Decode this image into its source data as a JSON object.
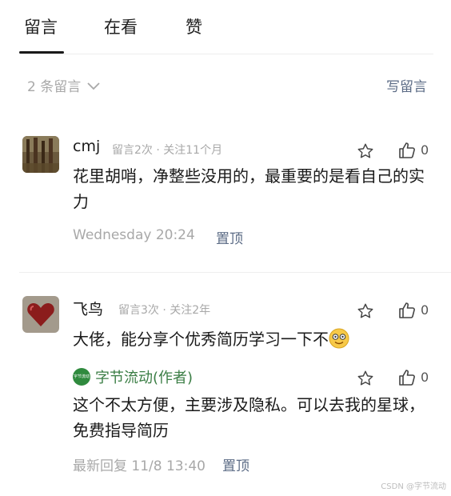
{
  "tabs": [
    {
      "label": "留言",
      "active": true
    },
    {
      "label": "在看"
    },
    {
      "label": "赞"
    }
  ],
  "sort": {
    "count_label": "2 条留言",
    "write_label": "写留言"
  },
  "comments": [
    {
      "name": "cmj",
      "meta": "留言2次 · 关注11个月",
      "likes": "0",
      "text": "花里胡哨，净整些没用的，最重要的是看自己的实力",
      "time": "Wednesday  20:24",
      "pin_label": "置顶"
    },
    {
      "name": "飞鸟",
      "meta": "留言3次 · 关注2年",
      "likes": "0",
      "text": "大佬，能分享个优秀简历学习一下不",
      "reply": {
        "author": "字节流动(作者)",
        "badge": "字节流动",
        "likes": "0",
        "text": "这个不太方便，主要涉及隐私。可以去我的星球，免费指导简历"
      },
      "time": "最新回复 11/8 13:40",
      "pin_label": "置顶"
    }
  ],
  "watermark": "CSDN @字节流动",
  "icons": [
    "chevron-down-icon",
    "star-icon",
    "thumbs-up-icon",
    "emoji-icon"
  ],
  "colors": {
    "link": "#5b6b85",
    "muted": "#a8a8a8",
    "author": "#3a7d44"
  }
}
